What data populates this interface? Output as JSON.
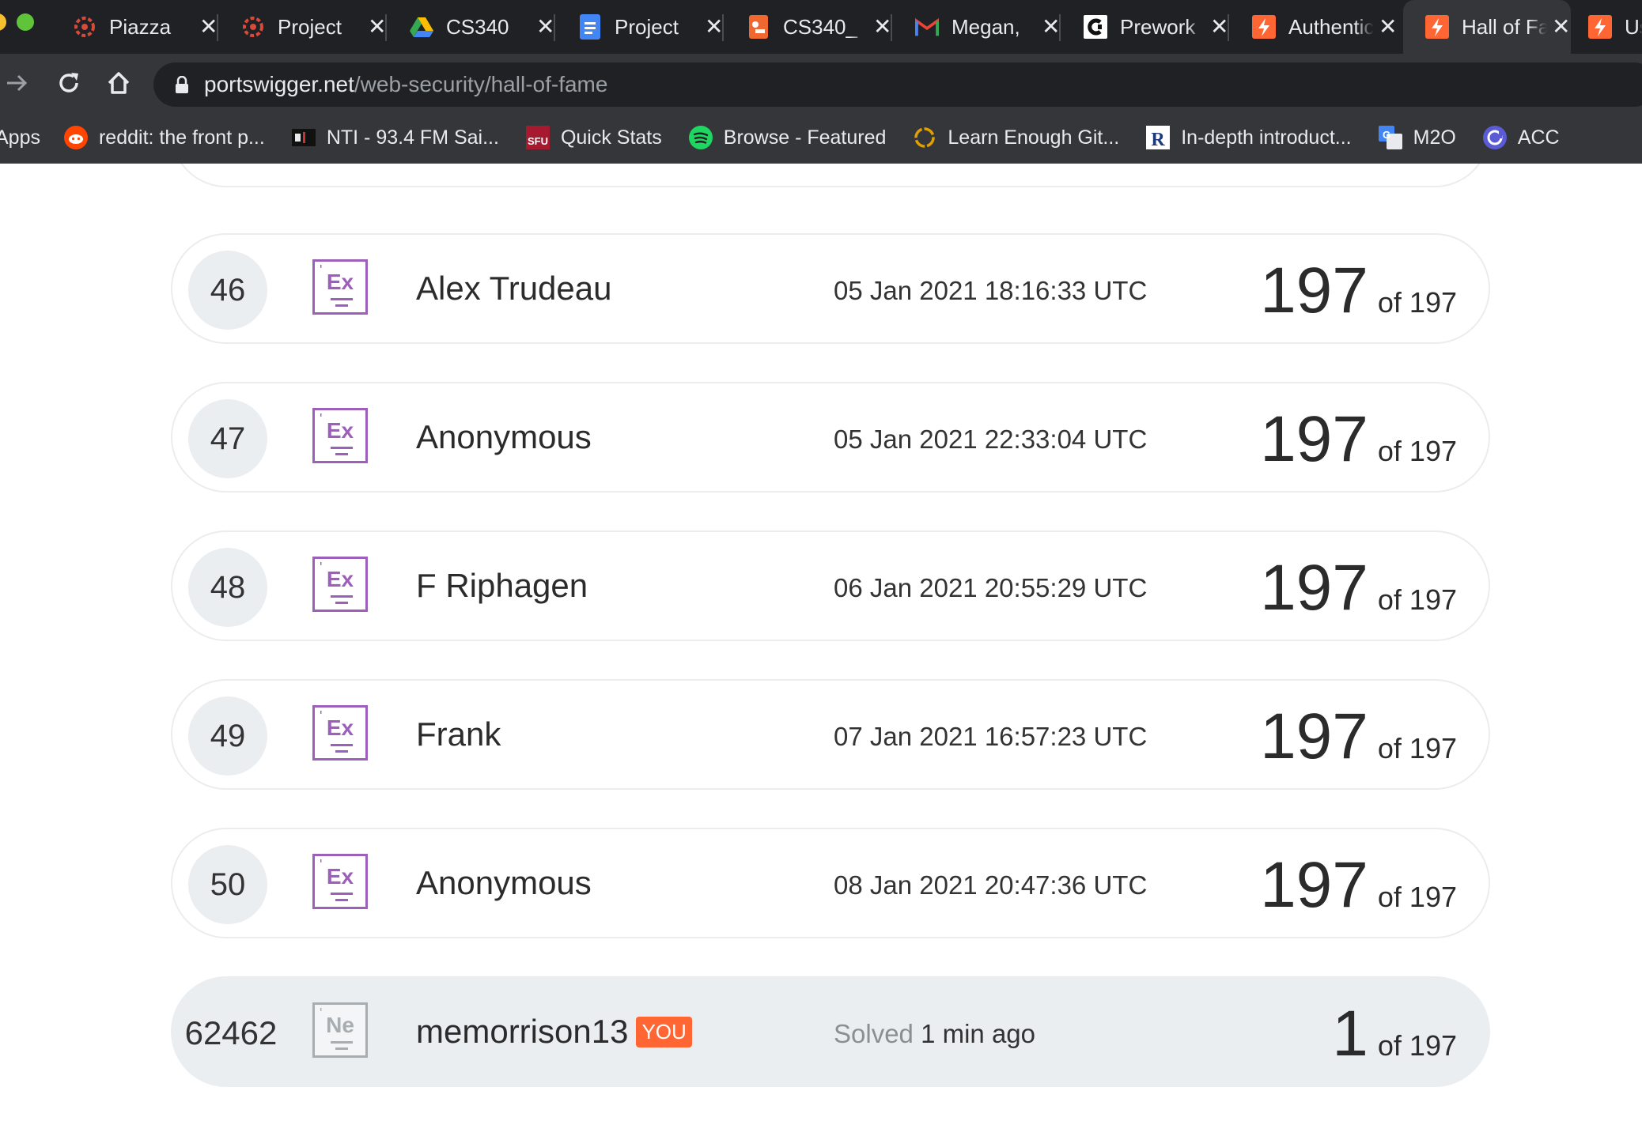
{
  "tabs": [
    {
      "label": "Piazza",
      "icon": "piazza-icon"
    },
    {
      "label": "Project",
      "icon": "piazza-icon"
    },
    {
      "label": "CS340",
      "icon": "google-drive-icon"
    },
    {
      "label": "Project",
      "icon": "google-docs-icon"
    },
    {
      "label": "CS340_",
      "icon": "coursys-icon"
    },
    {
      "label": "Megan,",
      "icon": "gmail-icon"
    },
    {
      "label": "Prework",
      "icon": "codepath-icon"
    },
    {
      "label": "Authentic",
      "icon": "portswigger-icon"
    },
    {
      "label": "Hall of Fame",
      "icon": "portswigger-icon"
    },
    {
      "label": "Us",
      "icon": "portswigger-icon"
    }
  ],
  "address_bar": {
    "domain": "portswigger.net",
    "path": "/web-security/hall-of-fame"
  },
  "bookmarks": [
    {
      "label": "Apps",
      "icon": "apps-grid-icon"
    },
    {
      "label": "reddit: the front p...",
      "icon": "reddit-icon"
    },
    {
      "label": "NTI - 93.4 FM Sai...",
      "icon": "radio-icon"
    },
    {
      "label": "Quick Stats",
      "icon": "sfu-icon"
    },
    {
      "label": "Browse - Featured",
      "icon": "spotify-icon"
    },
    {
      "label": "Learn Enough Git...",
      "icon": "learn-enough-icon"
    },
    {
      "label": "In-depth introduct...",
      "icon": "r-icon"
    },
    {
      "label": "M2O",
      "icon": "google-translate-icon"
    },
    {
      "label": "ACC",
      "icon": "acc-icon"
    }
  ],
  "leaderboard": [
    {
      "rank": "46",
      "badge": "Ex",
      "name": "Alex Trudeau",
      "time": "05 Jan 2021 18:16:33 UTC",
      "solved": "197",
      "of_label": "of 197"
    },
    {
      "rank": "47",
      "badge": "Ex",
      "name": "Anonymous",
      "time": "05 Jan 2021 22:33:04 UTC",
      "solved": "197",
      "of_label": "of 197"
    },
    {
      "rank": "48",
      "badge": "Ex",
      "name": "F Riphagen",
      "time": "06 Jan 2021 20:55:29 UTC",
      "solved": "197",
      "of_label": "of 197"
    },
    {
      "rank": "49",
      "badge": "Ex",
      "name": "Frank",
      "time": "07 Jan 2021 16:57:23 UTC",
      "solved": "197",
      "of_label": "of 197"
    },
    {
      "rank": "50",
      "badge": "Ex",
      "name": "Anonymous",
      "time": "08 Jan 2021 20:47:36 UTC",
      "solved": "197",
      "of_label": "of 197"
    }
  ],
  "current_user": {
    "rank": "62462",
    "badge": "Ne",
    "name": "memorrison13",
    "you_label": "YOU",
    "solved_label": "Solved",
    "solved_when": "1 min ago",
    "solved": "1",
    "of_label": "of 197"
  },
  "colors": {
    "expert_badge": "#9c5fba",
    "newcomer_badge": "#a8adb2",
    "you_tag": "#ff6633",
    "row_border": "#eaedf0",
    "row_highlight": "#ebeef1"
  }
}
